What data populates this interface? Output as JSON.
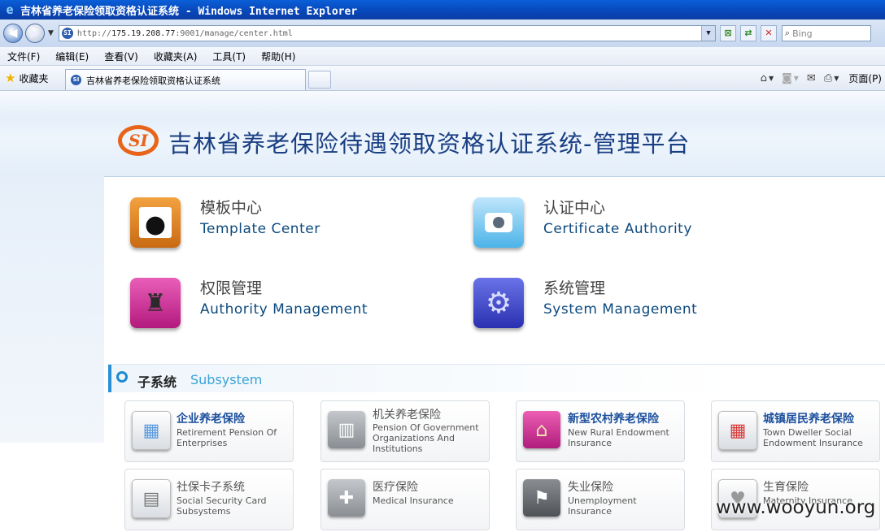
{
  "window": {
    "title": "吉林省养老保险领取资格认证系统 - Windows Internet Explorer"
  },
  "address": {
    "protocol": "http://",
    "host": "175.19.208.77",
    "rest": ":9001/manage/center.html"
  },
  "search": {
    "placeholder": "Bing"
  },
  "menu": [
    "文件(F)",
    "编辑(E)",
    "查看(V)",
    "收藏夹(A)",
    "工具(T)",
    "帮助(H)"
  ],
  "favorites": {
    "label": "收藏夹"
  },
  "tab": {
    "title": "吉林省养老保险领取资格认证系统"
  },
  "toolbar": {
    "page_label": "页面(P)"
  },
  "banner": {
    "title": "吉林省养老保险待遇领取资格认证系统-管理平台",
    "logo_text": "SI"
  },
  "modules": [
    {
      "cn": "模板中心",
      "en": "Template  Center"
    },
    {
      "cn": "认证中心",
      "en": "Certificate  Authority"
    },
    {
      "cn": "权限管理",
      "en": "Authority Management"
    },
    {
      "cn": "系统管理",
      "en": "System  Management"
    }
  ],
  "subsystem": {
    "title_cn": "子系统",
    "title_en": "Subsystem"
  },
  "subsystems": [
    {
      "cn": "企业养老保险",
      "en": "Retirement  Pension Of  Enterprises"
    },
    {
      "cn": "机关养老保险",
      "en": "Pension Of Government Organizations And Institutions"
    },
    {
      "cn": "新型农村养老保险",
      "en": "New Rural Endowment Insurance"
    },
    {
      "cn": "城镇居民养老保险",
      "en": "Town Dweller Social Endowment Insurance"
    },
    {
      "cn": "社保卡子系统",
      "en": "Social Security Card Subsystems"
    },
    {
      "cn": "医疗保险",
      "en": "Medical  Insurance"
    },
    {
      "cn": "失业保险",
      "en": "Unemployment Insurance"
    },
    {
      "cn": "生育保险",
      "en": "Maternity  Insurance"
    }
  ],
  "watermark": "www.wooyun.org"
}
